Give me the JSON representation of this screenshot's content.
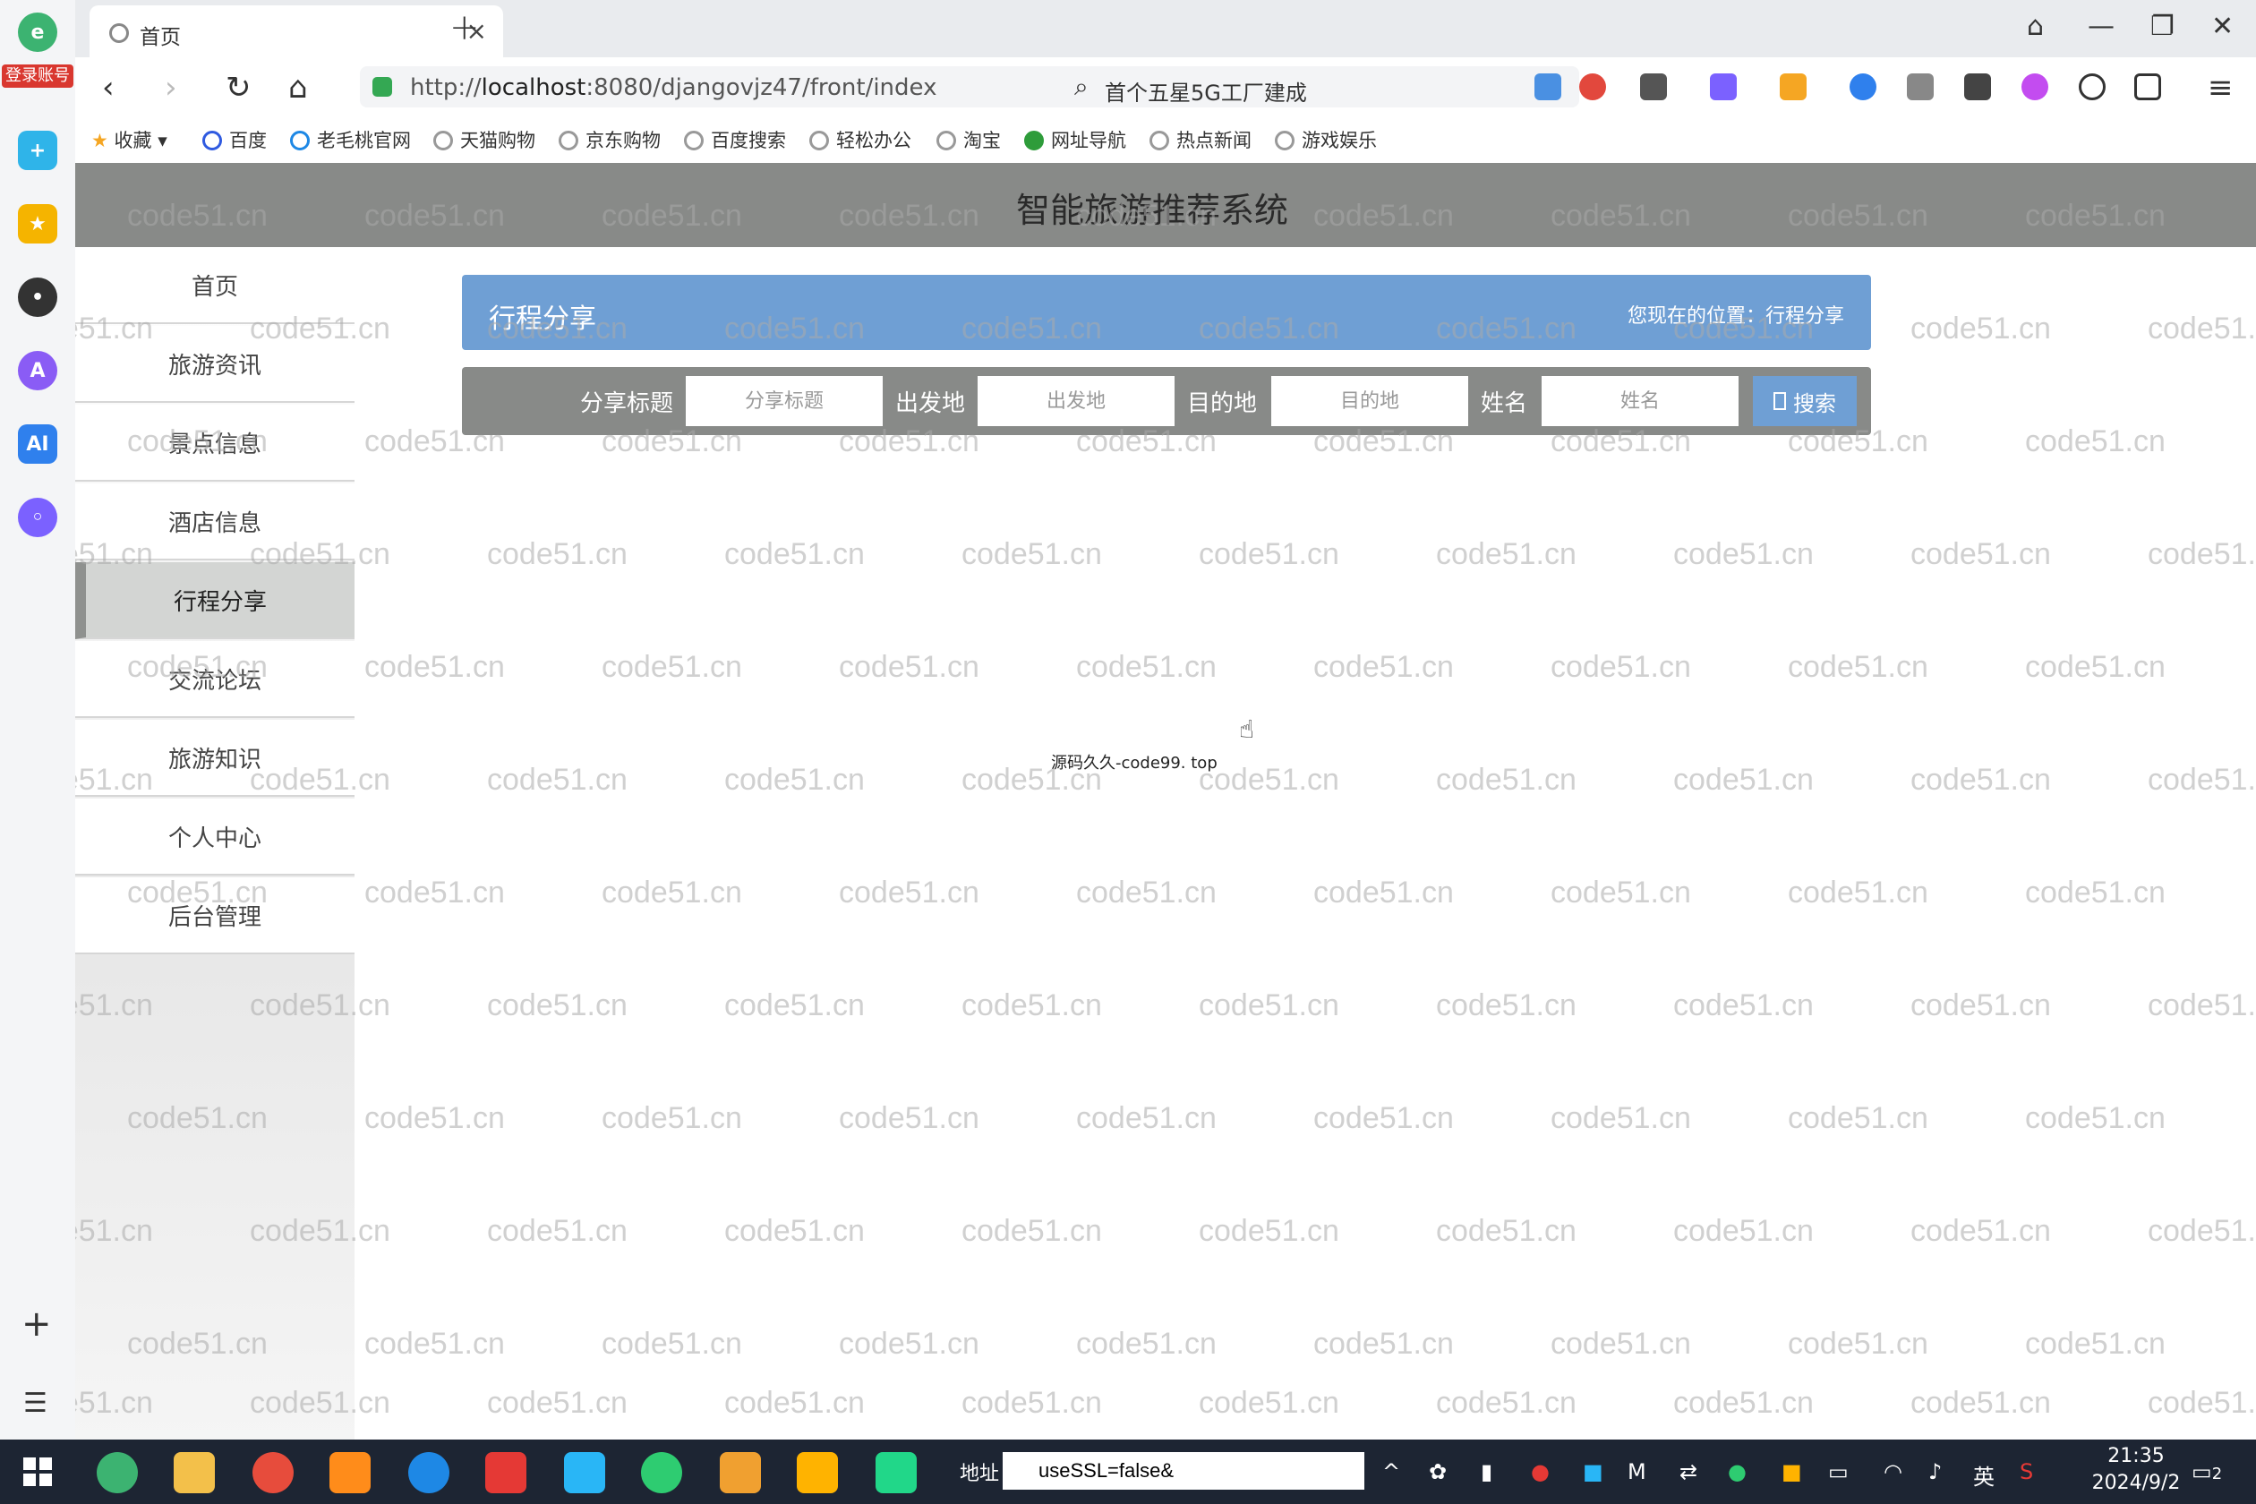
{
  "browser": {
    "tab_title": "首页",
    "url_prefix": "http://",
    "url_host": "localhost",
    "url_rest": ":8080/djangovjz47/front/index",
    "search_query": "首个五星5G工厂建成",
    "login_badge": "登录账号"
  },
  "bookmarks": [
    {
      "label": "收藏"
    },
    {
      "label": "百度"
    },
    {
      "label": "老毛桃官网"
    },
    {
      "label": "天猫购物"
    },
    {
      "label": "京东购物"
    },
    {
      "label": "百度搜索"
    },
    {
      "label": "轻松办公"
    },
    {
      "label": "淘宝"
    },
    {
      "label": "网址导航"
    },
    {
      "label": "热点新闻"
    },
    {
      "label": "游戏娱乐"
    }
  ],
  "site": {
    "title": "智能旅游推荐系统",
    "menu": [
      {
        "label": "首页"
      },
      {
        "label": "旅游资讯"
      },
      {
        "label": "景点信息"
      },
      {
        "label": "酒店信息"
      },
      {
        "label": "行程分享",
        "active": true
      },
      {
        "label": "交流论坛"
      },
      {
        "label": "旅游知识"
      },
      {
        "label": "个人中心"
      },
      {
        "label": "后台管理"
      }
    ]
  },
  "crumb": {
    "title": "行程分享",
    "location": "您现在的位置：行程分享"
  },
  "filters": {
    "share_title_label": "分享标题",
    "share_title_placeholder": "分享标题",
    "origin_label": "出发地",
    "origin_placeholder": "出发地",
    "destination_label": "目的地",
    "destination_placeholder": "目的地",
    "name_label": "姓名",
    "name_placeholder": "姓名",
    "search_label": "搜索"
  },
  "footer_text": "源码久久-code99. top",
  "watermark": "code51.cn",
  "taskbar": {
    "address_label": "地址",
    "address_value": "useSSL=false&",
    "ime": "英",
    "time": "21:35",
    "date": "2024/9/2",
    "notification_count": "2"
  },
  "colors": {
    "header_gray": "#888a88",
    "accent_blue": "#6f9fd4",
    "taskbar": "#1d2533"
  }
}
